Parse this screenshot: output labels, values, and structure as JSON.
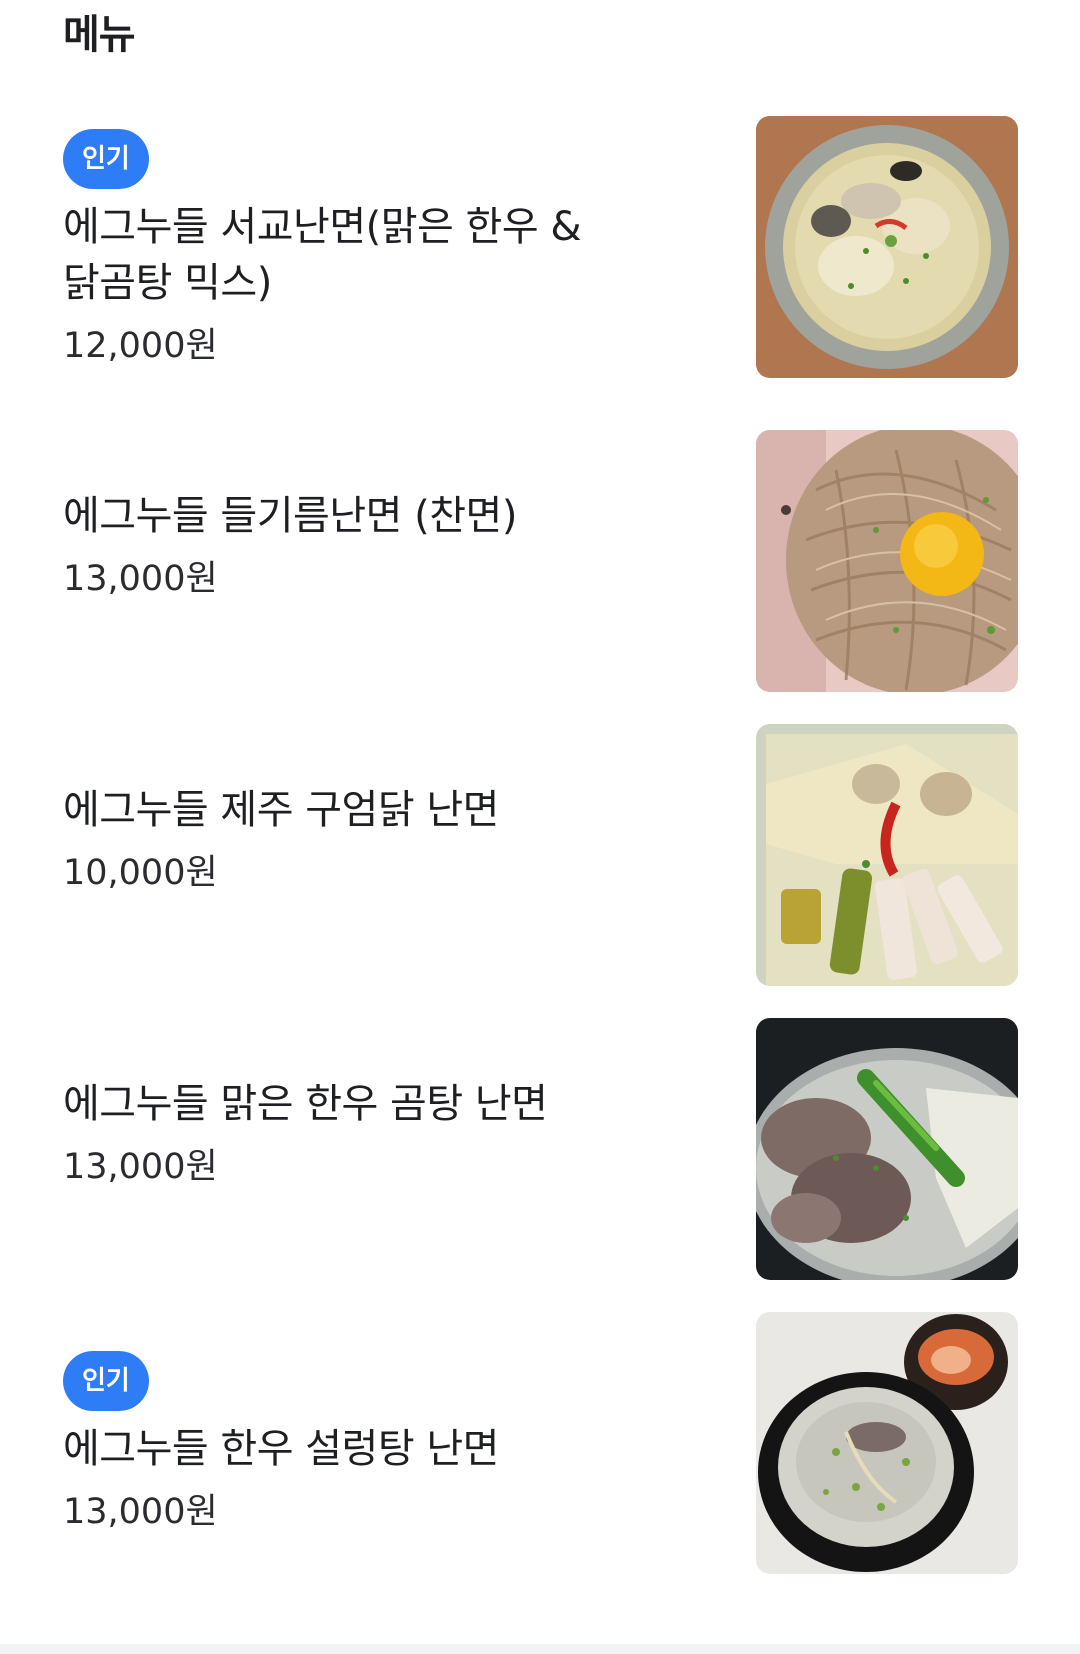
{
  "section": {
    "title": "메뉴"
  },
  "menu_items": [
    {
      "badge": "인기",
      "name": "에그누들 서교난면(맑은 한우 &\n닭곰탕 믹스)",
      "price": "12,000원",
      "image_icon": "clear-broth-noodle-bowl"
    },
    {
      "badge": "",
      "name": "에그누들 들기름난면 (찬면)",
      "price": "13,000원",
      "image_icon": "perilla-oil-noodles-with-egg-yolk"
    },
    {
      "badge": "",
      "name": "에그누들 제주 구엄닭 난면",
      "price": "10,000원",
      "image_icon": "chicken-noodle-soup"
    },
    {
      "badge": "",
      "name": "에그누들 맑은 한우 곰탕 난면",
      "price": "13,000원",
      "image_icon": "beef-bone-soup-noodles"
    },
    {
      "badge": "인기",
      "name": "에그누들 한우 설렁탕 난면",
      "price": "13,000원",
      "image_icon": "seolleongtang-with-kimchi"
    }
  ],
  "colors": {
    "badge_bg": "#2e7df7",
    "text": "#1e1f22"
  }
}
